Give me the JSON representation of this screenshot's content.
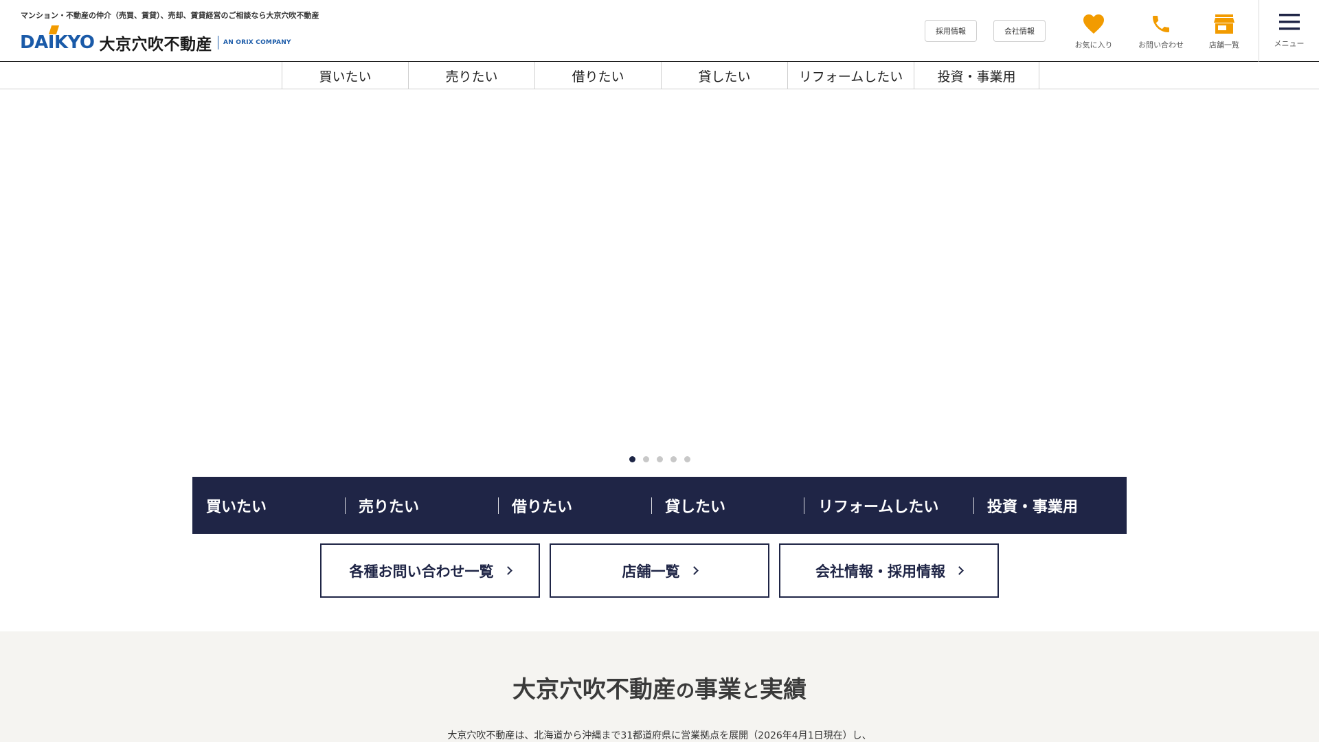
{
  "header": {
    "tagline": "マンション・不動産の仲介（売買、賃貸）、売却、賃貸経営のご相談なら大京穴吹不動産",
    "logo": {
      "mark": "DAIKYO",
      "name": "大京穴吹不動産",
      "orix": "AN ORIX COMPANY"
    },
    "buttons": {
      "recruit": "採用情報",
      "company": "会社情報"
    },
    "icons": {
      "favorites": {
        "label": "お気に入り",
        "icon": "heart-icon"
      },
      "contact": {
        "label": "お問い合わせ",
        "icon": "phone-icon"
      },
      "stores": {
        "label": "店舗一覧",
        "icon": "store-icon"
      },
      "menu": {
        "label": "メニュー",
        "icon": "hamburger-icon"
      }
    },
    "accent_color": "#f29b00"
  },
  "topnav": {
    "items": [
      "買いたい",
      "売りたい",
      "借りたい",
      "貸したい",
      "リフォームしたい",
      "投資・事業用"
    ]
  },
  "slider": {
    "total": 5,
    "active": 1
  },
  "darkbar": {
    "items": [
      "買いたい",
      "売りたい",
      "借りたい",
      "貸したい",
      "リフォームしたい",
      "投資・事業用"
    ],
    "color": "#1f2546"
  },
  "links": {
    "contact_list": "各種お問い合わせ一覧",
    "stores": "店舗一覧",
    "company_recruit": "会社情報・採用情報"
  },
  "business": {
    "title_main": "大京穴吹不動産",
    "title_connector_1": "の",
    "title_part_2": "事業",
    "title_connector_2": "と",
    "title_part_3": "実績",
    "text": "大京穴吹不動産は、北海道から沖縄まで31都道府県に営業拠点を展開（2026年4月1日現在）し、"
  }
}
